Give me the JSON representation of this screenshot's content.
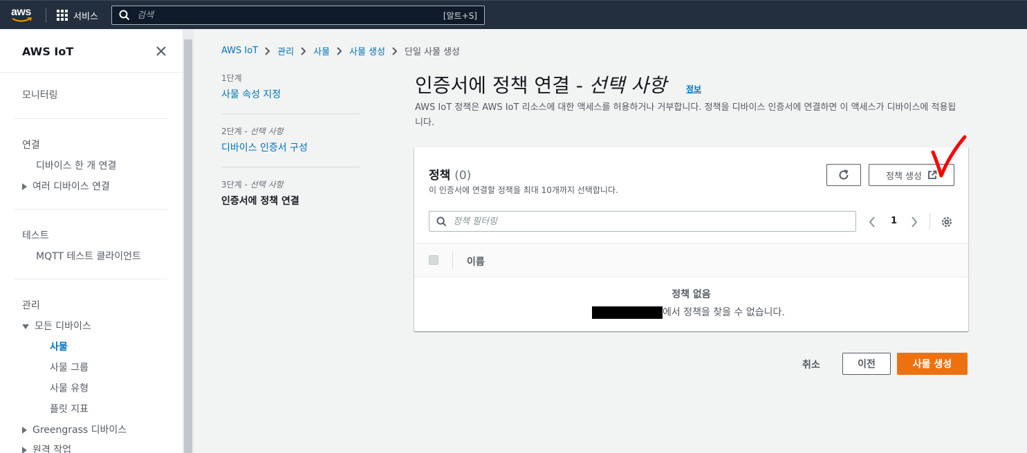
{
  "topnav": {
    "logo_text": "aws",
    "services_label": "서비스",
    "search_placeholder": "검색",
    "search_shortcut": "[알트+S]"
  },
  "sidebar": {
    "title": "AWS IoT",
    "monitoring": "모니터링",
    "connect_header": "연결",
    "connect_one": "디바이스 한 개 연결",
    "connect_many": "여러 디바이스 연결",
    "test_header": "테스트",
    "mqtt_client": "MQTT 테스트 클라이언트",
    "manage_header": "관리",
    "all_devices": "모든 디바이스",
    "things": "사물",
    "thing_groups": "사물 그룹",
    "thing_types": "사물 유형",
    "fleet_metrics": "플릿 지표",
    "greengrass": "Greengrass 디바이스",
    "remote_ops": "원격 작업"
  },
  "breadcrumb": {
    "items": [
      "AWS IoT",
      "관리",
      "사물",
      "사물 생성"
    ],
    "current": "단일 사물 생성"
  },
  "steps": {
    "step1_label": "1단계",
    "step1_title": "사물 속성 지정",
    "step2_label_prefix": "2단계 - ",
    "step2_label_optional": "선택 사항",
    "step2_title": "디바이스 인증서 구성",
    "step3_label_prefix": "3단계 - ",
    "step3_label_optional": "선택 사항",
    "step3_title": "인증서에 정책 연결"
  },
  "main": {
    "title": "인증서에 정책 연결 - ",
    "title_optional": "선택 사항",
    "info_link": "정보",
    "description": "AWS IoT 정책은 AWS IoT 리소스에 대한 액세스를 허용하거나 거부합니다. 정책을 디바이스 인증서에 연결하면 이 액세스가 디바이스에 적용됩니다."
  },
  "panel": {
    "title": "정책",
    "count": "(0)",
    "subtitle": "이 인증서에 연결할 정책을 최대 10개까지 선택합니다.",
    "create_policy_label": "정책 생성",
    "filter_placeholder": "정책 필터링",
    "page_number": "1",
    "column_name": "이름",
    "empty_title": "정책 없음",
    "empty_desc": "에서 정책을 찾을 수 없습니다."
  },
  "footer": {
    "cancel_label": "취소",
    "prev_label": "이전",
    "create_thing_label": "사물 생성"
  },
  "colors": {
    "topnav_bg": "#232f3e",
    "link": "#0073bb",
    "primary_button": "#ec7211",
    "annotation_red": "#ff0000"
  },
  "icons": [
    "grid-icon",
    "search-icon",
    "close-icon",
    "chevron-right-icon",
    "refresh-icon",
    "external-link-icon",
    "chevron-left-icon",
    "settings-icon",
    "checkmark-annotation"
  ]
}
